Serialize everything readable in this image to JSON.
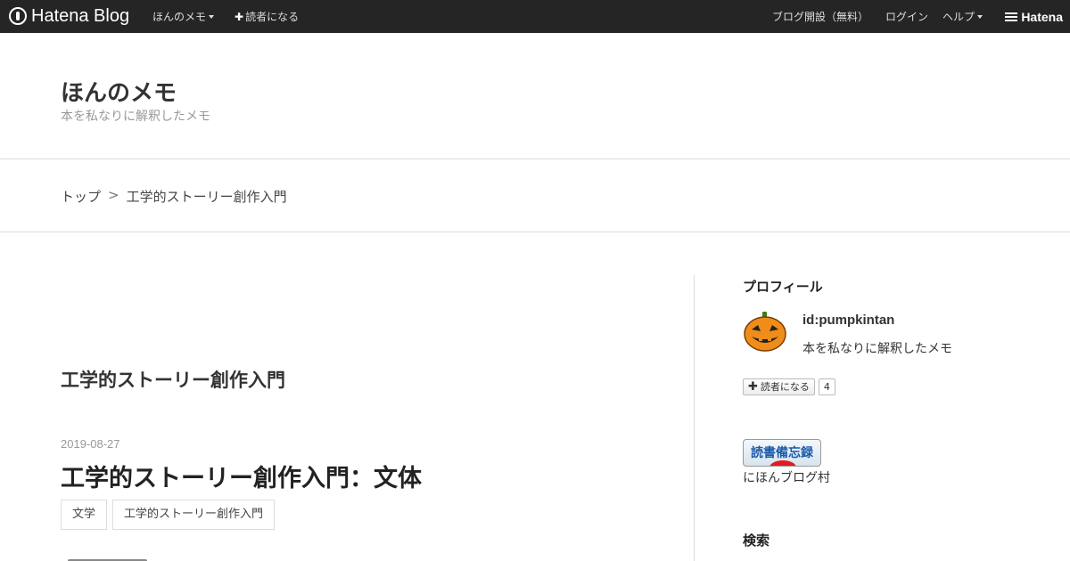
{
  "topbar": {
    "logo_text": "Hatena Blog",
    "blog_menu": "ほんのメモ",
    "subscribe": "読者になる",
    "open_blog": "ブログ開設（無料）",
    "login": "ログイン",
    "help": "ヘルプ",
    "brand": "Hatena"
  },
  "header": {
    "title": "ほんのメモ",
    "description": "本を私なりに解釈したメモ"
  },
  "breadcrumb": {
    "top": "トップ",
    "separator": ">",
    "current": "工学的ストーリー創作入門"
  },
  "main": {
    "category_title": "工学的ストーリー創作入門",
    "entry": {
      "date": "2019-08-27",
      "title": "工学的ストーリー創作入門：文体",
      "tags": [
        "文学",
        "工学的ストーリー創作入門"
      ]
    }
  },
  "sidebar": {
    "profile_heading": "プロフィール",
    "profile_id": "id:pumpkintan",
    "profile_desc": "本を私なりに解釈したメモ",
    "subscribe_label": "読者になる",
    "subscriber_count": "4",
    "banner_text": "読書備忘録",
    "village_link": "にほんブログ村",
    "search_heading": "検索"
  },
  "colors": {
    "topbar_bg": "#252525",
    "banner_blue": "#1a5aa8",
    "pumpkin_orange": "#f08c1a"
  }
}
